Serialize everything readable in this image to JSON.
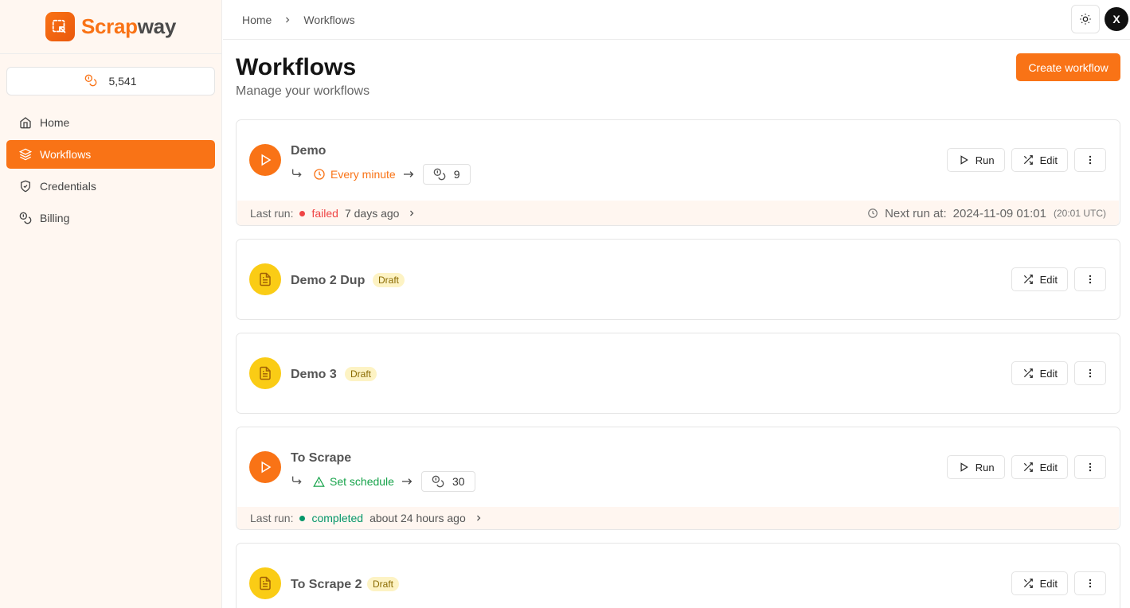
{
  "brand": {
    "name_part1": "Scrap",
    "name_part2": "way"
  },
  "credits": {
    "icon": "coins-icon",
    "balance": "5,541"
  },
  "sidebar": {
    "items": [
      {
        "label": "Home",
        "icon": "home-icon"
      },
      {
        "label": "Workflows",
        "icon": "layers-icon",
        "active": true
      },
      {
        "label": "Credentials",
        "icon": "shield-icon"
      },
      {
        "label": "Billing",
        "icon": "coins-icon"
      }
    ]
  },
  "breadcrumb": {
    "home": "Home",
    "current": "Workflows"
  },
  "header": {
    "avatar_initial": "X",
    "theme_icon": "sun-icon"
  },
  "page": {
    "title": "Workflows",
    "subtitle": "Manage your workflows",
    "create_label": "Create workflow"
  },
  "colors": {
    "accent": "#f97316",
    "draft": "#facc15",
    "failed": "#ef4444",
    "completed": "#059669"
  },
  "workflows": [
    {
      "name": "Demo",
      "status": "published",
      "schedule": "Every minute",
      "cost": "9",
      "run_label": "Run",
      "edit_label": "Edit",
      "last_run_label": "Last run:",
      "last_run_status": "failed",
      "last_run_time": "7 days ago",
      "next_run_label": "Next run at:",
      "next_run_time": "2024-11-09 01:01",
      "next_run_utc": "(20:01 UTC)"
    },
    {
      "name": "Demo 2 Dup",
      "status": "draft",
      "badge": "Draft",
      "edit_label": "Edit"
    },
    {
      "name": "Demo 3",
      "status": "draft",
      "badge": "Draft",
      "edit_label": "Edit"
    },
    {
      "name": "To Scrape",
      "status": "published",
      "schedule": "Set schedule",
      "cost": "30",
      "run_label": "Run",
      "edit_label": "Edit",
      "last_run_label": "Last run:",
      "last_run_status": "completed",
      "last_run_time": "about 24 hours ago"
    },
    {
      "name": "To Scrape 2",
      "status": "draft",
      "badge": "Draft",
      "edit_label": "Edit"
    }
  ]
}
